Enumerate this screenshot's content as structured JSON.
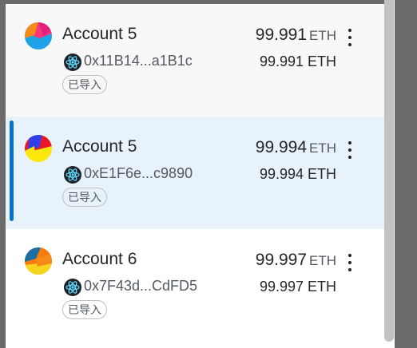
{
  "accounts": [
    {
      "name": "Account 5",
      "address": "0x11B14...a1B1c",
      "tag": "已导入",
      "balance": "99.991",
      "unit": "ETH",
      "balance_sub": "99.991 ETH",
      "selected": false,
      "avatar_icon": "jazzicon-avatar",
      "network_icon": "react-atom-icon"
    },
    {
      "name": "Account 5",
      "address": "0xE1F6e...c9890",
      "tag": "已导入",
      "balance": "99.994",
      "unit": "ETH",
      "balance_sub": "99.994 ETH",
      "selected": true,
      "avatar_icon": "jazzicon-avatar",
      "network_icon": "react-atom-icon"
    },
    {
      "name": "Account 6",
      "address": "0x7F43d...CdFD5",
      "tag": "已导入",
      "balance": "99.997",
      "unit": "ETH",
      "balance_sub": "99.997 ETH",
      "selected": false,
      "avatar_icon": "jazzicon-avatar",
      "network_icon": "react-atom-icon"
    }
  ],
  "colors": {
    "selected_accent": "#0376c9",
    "selected_background": "#e8f2fa",
    "text_primary": "#24272a",
    "text_secondary": "#535a61"
  },
  "menu_icon": "more-vertical-icon"
}
